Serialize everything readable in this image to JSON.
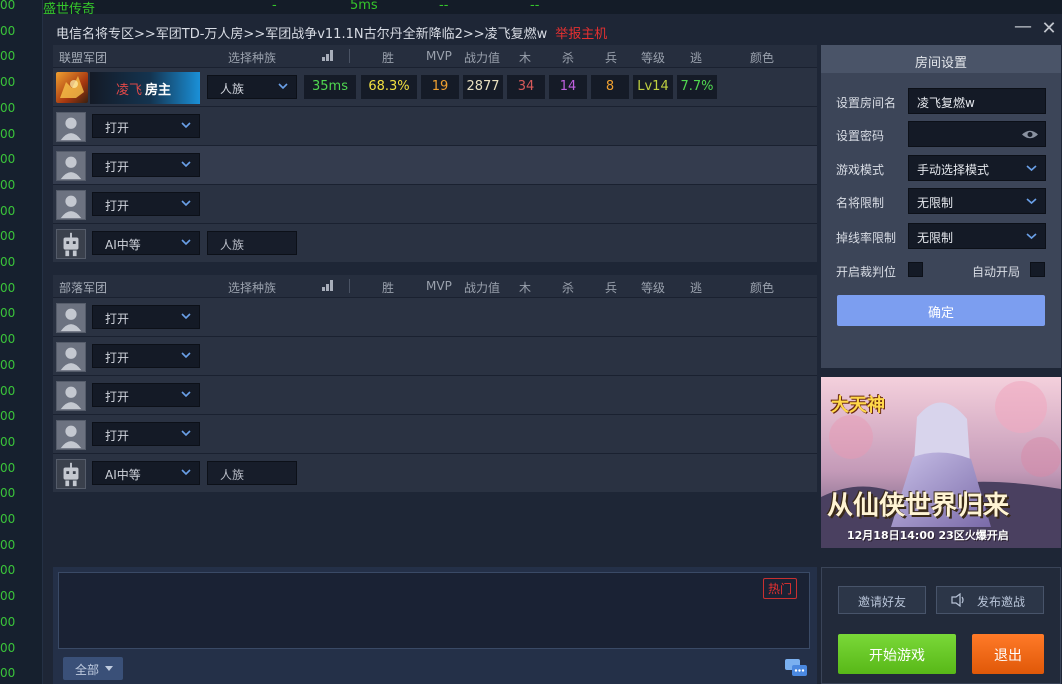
{
  "background_list": {
    "row_numbers": [
      "00",
      "00",
      "00",
      "00",
      "00",
      "00",
      "00",
      "00",
      "00",
      "00",
      "00",
      "00",
      "00",
      "00",
      "00",
      "00",
      "00",
      "00",
      "00",
      "00",
      "00",
      "00",
      "00",
      "00",
      "00",
      "00",
      "00"
    ],
    "top_row": {
      "name": "盛世传奇",
      "col1": "-",
      "ping": "5ms",
      "col3": "--",
      "col4": "--"
    }
  },
  "window": {
    "title": "电信名将专区>>军团TD-万人房>>军团战争v11.1N古尔丹全新降临2>>凌飞复燃w",
    "report_label": "举报主机",
    "minimize_glyph": "—",
    "close_glyph": "✕"
  },
  "columns": {
    "race": "选择种族",
    "win": "胜",
    "mvp": "MVP",
    "power": "战力值",
    "wood": "木",
    "kill": "杀",
    "soldier": "兵",
    "level": "等级",
    "escape": "逃",
    "color": "颜色"
  },
  "alliance": {
    "name": "联盟军团",
    "host": {
      "name": "凌飞",
      "tag": "房主",
      "race": "人族",
      "ping": "35ms",
      "win_rate": "68.3%",
      "mvp": "19",
      "power": "2877",
      "wood": "34",
      "kill": "14",
      "soldier": "8",
      "level": "Lv14",
      "escape_rate": "7.7%"
    },
    "slots": [
      {
        "status": "打开"
      },
      {
        "status": "打开"
      },
      {
        "status": "打开"
      }
    ],
    "ai_slot": {
      "difficulty": "AI中等",
      "race": "人族"
    }
  },
  "horde": {
    "name": "部落军团",
    "slots": [
      {
        "status": "打开"
      },
      {
        "status": "打开"
      },
      {
        "status": "打开"
      },
      {
        "status": "打开"
      }
    ],
    "ai_slot": {
      "difficulty": "AI中等",
      "race": "人族"
    }
  },
  "settings": {
    "header": "房间设置",
    "room_name_label": "设置房间名",
    "room_name": "凌飞复燃w",
    "password_label": "设置密码",
    "password": "",
    "mode_label": "游戏模式",
    "mode": "手动选择模式",
    "name_limit_label": "名将限制",
    "name_limit": "无限制",
    "drop_limit_label": "掉线率限制",
    "drop_limit": "无限制",
    "referee_label": "开启裁判位",
    "auto_start_label": "自动开局",
    "confirm": "确定"
  },
  "ad": {
    "logo": "大天神",
    "slogan": "从仙侠世界归来",
    "date": "12月18日14:00 23区火爆开启"
  },
  "chat": {
    "hot_label": "热门",
    "channel": "全部"
  },
  "actions": {
    "invite": "邀请好友",
    "broadcast": "发布邀战",
    "start": "开始游戏",
    "exit": "退出"
  },
  "colors": {
    "win": "#f2e040",
    "mvp": "#f0a030",
    "power": "#e8e0c0",
    "wood": "#d85a5a",
    "kill": "#c060e0",
    "soldier": "#f0a030",
    "level": "#c0d040",
    "escape": "#50d850",
    "ping": "#50d850",
    "report": "#e53030",
    "confirm": "#7c9ef0",
    "start": "#6ac828",
    "exit": "#f06818"
  }
}
